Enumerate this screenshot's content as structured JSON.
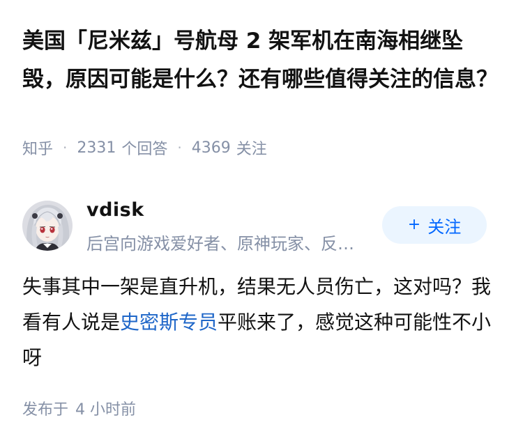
{
  "question": {
    "title": "美国「尼米兹」号航母 2 架军机在南海相继坠毁，原因可能是什么？还有哪些值得关注的信息？",
    "source": "知乎",
    "answer_count": "2331",
    "answer_label": "个回答",
    "follow_count": "4369",
    "follow_label": "关注"
  },
  "answer": {
    "author": {
      "name": "vdisk",
      "bio": "后宫向游戏爱好者、原神玩家、反…"
    },
    "follow_button": {
      "plus": "+",
      "label": "关注"
    },
    "content": {
      "part1": "失事其中一架是直升机，结果无人员伤亡，这对吗？我看有人说是",
      "link": "史密斯专员",
      "part2": "平账来了，感觉这种可能性不小呀"
    },
    "publish": {
      "label": "发布于",
      "time": "4 小时前"
    }
  },
  "colors": {
    "accent": "#0066ff",
    "link": "#1e66c8",
    "meta_text": "#8590a6",
    "follow_bg": "#ebf5ff"
  },
  "icons": {
    "avatar": "anime-girl-avatar"
  }
}
